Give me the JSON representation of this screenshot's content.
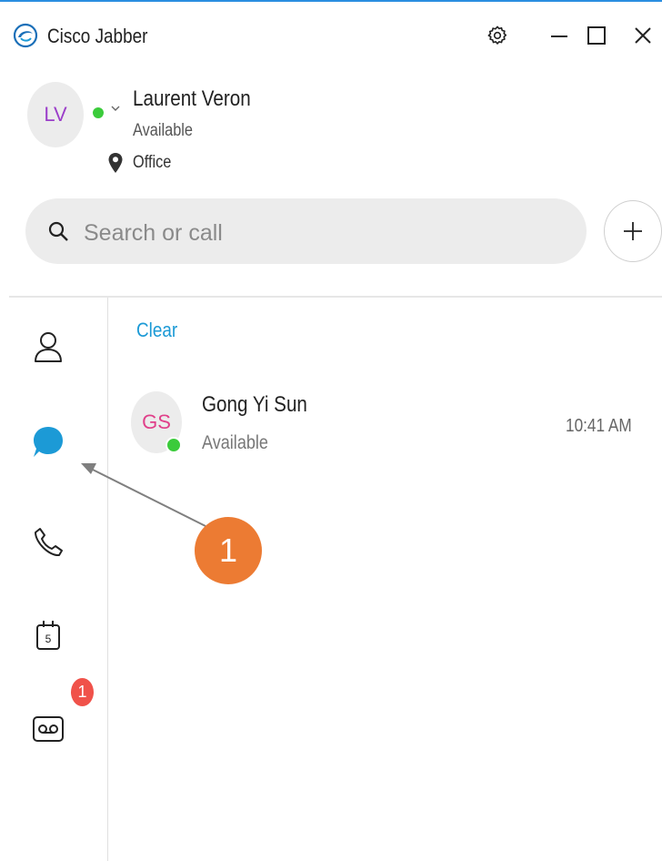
{
  "app": {
    "title": "Cisco Jabber"
  },
  "window_controls": {
    "settings": "gear-icon",
    "minimize": "minus-icon",
    "maximize": "square-icon",
    "close": "close-icon"
  },
  "profile": {
    "initials": "LV",
    "name": "Laurent Veron",
    "status": "Available",
    "location": "Office",
    "status_color": "#3bcb3b"
  },
  "search": {
    "placeholder": "Search or call"
  },
  "sidebar": {
    "items": [
      {
        "id": "contacts",
        "icon": "person-icon",
        "active": false
      },
      {
        "id": "chats",
        "icon": "chat-bubble-icon",
        "active": true
      },
      {
        "id": "calls",
        "icon": "phone-icon",
        "active": false
      },
      {
        "id": "meetings",
        "icon": "calendar-icon",
        "day": "5",
        "active": false
      },
      {
        "id": "voicemail",
        "icon": "voicemail-icon",
        "badge": "1",
        "active": false
      }
    ]
  },
  "chats": {
    "clear_label": "Clear",
    "items": [
      {
        "initials": "GS",
        "name": "Gong Yi Sun",
        "status": "Available",
        "time": "10:41 AM"
      }
    ]
  },
  "callout": {
    "number": "1",
    "color": "#ec7b33"
  },
  "colors": {
    "accent": "#1c9ad6",
    "badge": "#f0524a",
    "presence": "#3bcb3b"
  }
}
